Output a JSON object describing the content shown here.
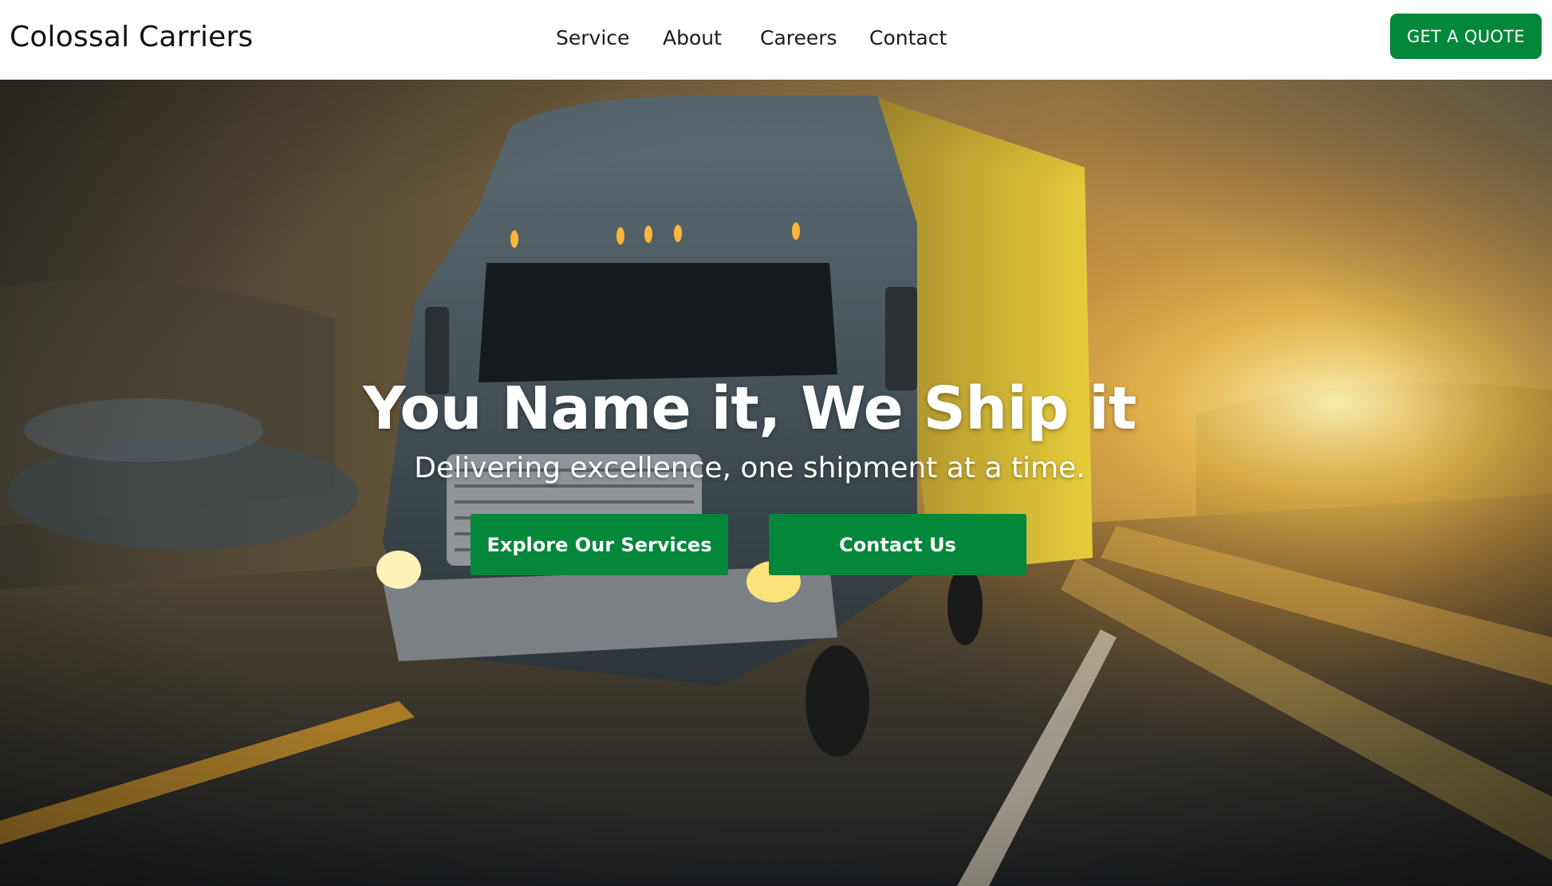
{
  "header": {
    "brand": "Colossal Carriers",
    "nav": [
      "Service",
      "About",
      "Careers",
      "Contact"
    ],
    "cta_label": "GET A QUOTE"
  },
  "hero": {
    "headline": "You Name it, We Ship it",
    "subheadline": "Delivering excellence, one shipment at a time.",
    "buttons": [
      "Explore Our Services",
      "Contact Us"
    ],
    "image": "semi-truck-highway-sunset-photo"
  },
  "colors": {
    "accent_green": "#03873a",
    "header_bg": "#ffffff",
    "brand_text": "#111111",
    "hero_text": "#ffffff"
  }
}
